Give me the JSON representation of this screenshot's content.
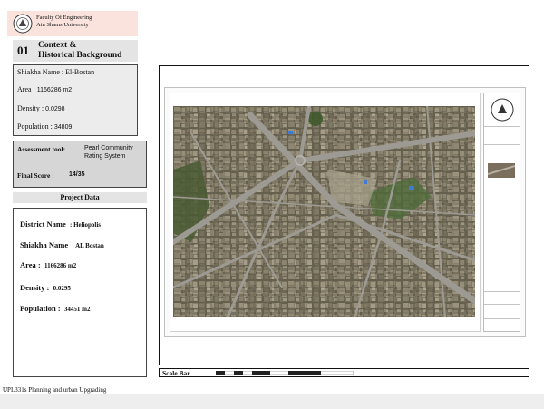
{
  "header": {
    "faculty": "Faculty Of Engineering",
    "university": "Ain Shams University"
  },
  "section": {
    "number": "01",
    "title_line1": "Context  &",
    "title_line2": "Historical Background"
  },
  "context": {
    "shiakha": "Shiakha Name : El-Bostan",
    "area_label": "Area :",
    "area_value": "1166286 m2",
    "density_label": "Density :",
    "density_value": "0.0298",
    "population_label": "Population :",
    "population_value": "34809"
  },
  "assessment": {
    "tool_label": "Assessment tool:",
    "tool_value": "Pearl Community Rating System",
    "score_label": "Final Score :",
    "score_value": "14/35"
  },
  "project_data": {
    "heading": "Project Data",
    "district_label": "District  Name",
    "district_value": ":  Heliopolis",
    "shiakha_label": "Shiakha  Name",
    "shiakha_value": ":  AL Bostan",
    "area_label": "Area :",
    "area_value": "1166286 m2",
    "density_label": "Density :",
    "density_value": "0.0295",
    "population_label": "Population :",
    "population_value": "34451   m2"
  },
  "map": {
    "scale_label": "Scale  Bar"
  },
  "footer": {
    "course": "UPL331s Planning and urban Upgrading"
  },
  "colors": {
    "logo_band": "#fbe3dd",
    "panel_grey": "#ececec",
    "tool_grey": "#d6d6d6",
    "aerial_base": "#5b5748"
  },
  "icons": [
    "university-logo-icon",
    "north-arrow-icon"
  ]
}
